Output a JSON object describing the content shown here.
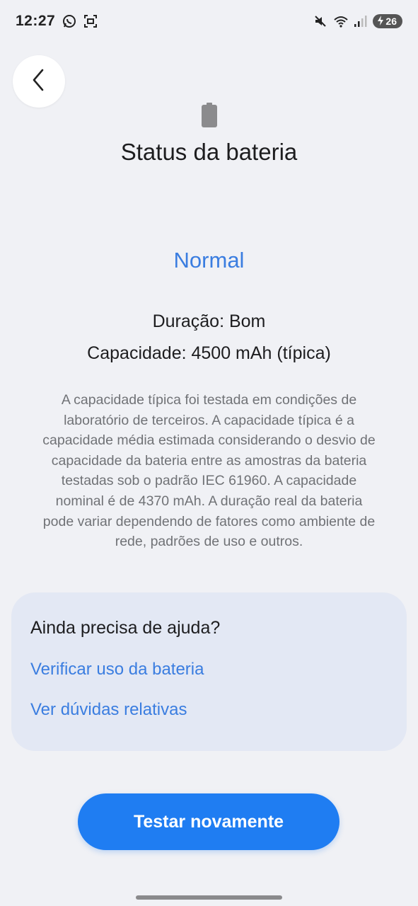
{
  "status_bar": {
    "time": "12:27",
    "battery_level": "26",
    "icons": [
      "whatsapp-icon",
      "screen-capture-icon",
      "mute-icon",
      "wifi-icon",
      "signal-icon",
      "battery-charging-icon"
    ]
  },
  "header": {
    "back_icon": "chevron-left-icon",
    "battery_icon": "battery-icon",
    "title": "Status da bateria"
  },
  "status": {
    "value": "Normal",
    "duration": "Duração: Bom",
    "capacity": "Capacidade: 4500 mAh (típica)",
    "description": "A capacidade típica foi testada em condições de laboratório de terceiros. A capacidade típica é a capacidade média estimada considerando o desvio de capacidade da bateria entre as amostras da bateria testadas sob o padrão IEC 61960. A capacidade nominal é de 4370 mAh. A duração real da bateria pode variar dependendo de fatores como ambiente de rede, padrões de uso e outros."
  },
  "help": {
    "title": "Ainda precisa de ajuda?",
    "links": [
      {
        "label": "Verificar uso da bateria"
      },
      {
        "label": "Ver dúvidas relativas"
      }
    ]
  },
  "actions": {
    "retest_label": "Testar novamente"
  },
  "colors": {
    "accent": "#3a7de0",
    "button": "#1f7df2",
    "background": "#f0f1f5",
    "card": "#e3e8f4"
  }
}
